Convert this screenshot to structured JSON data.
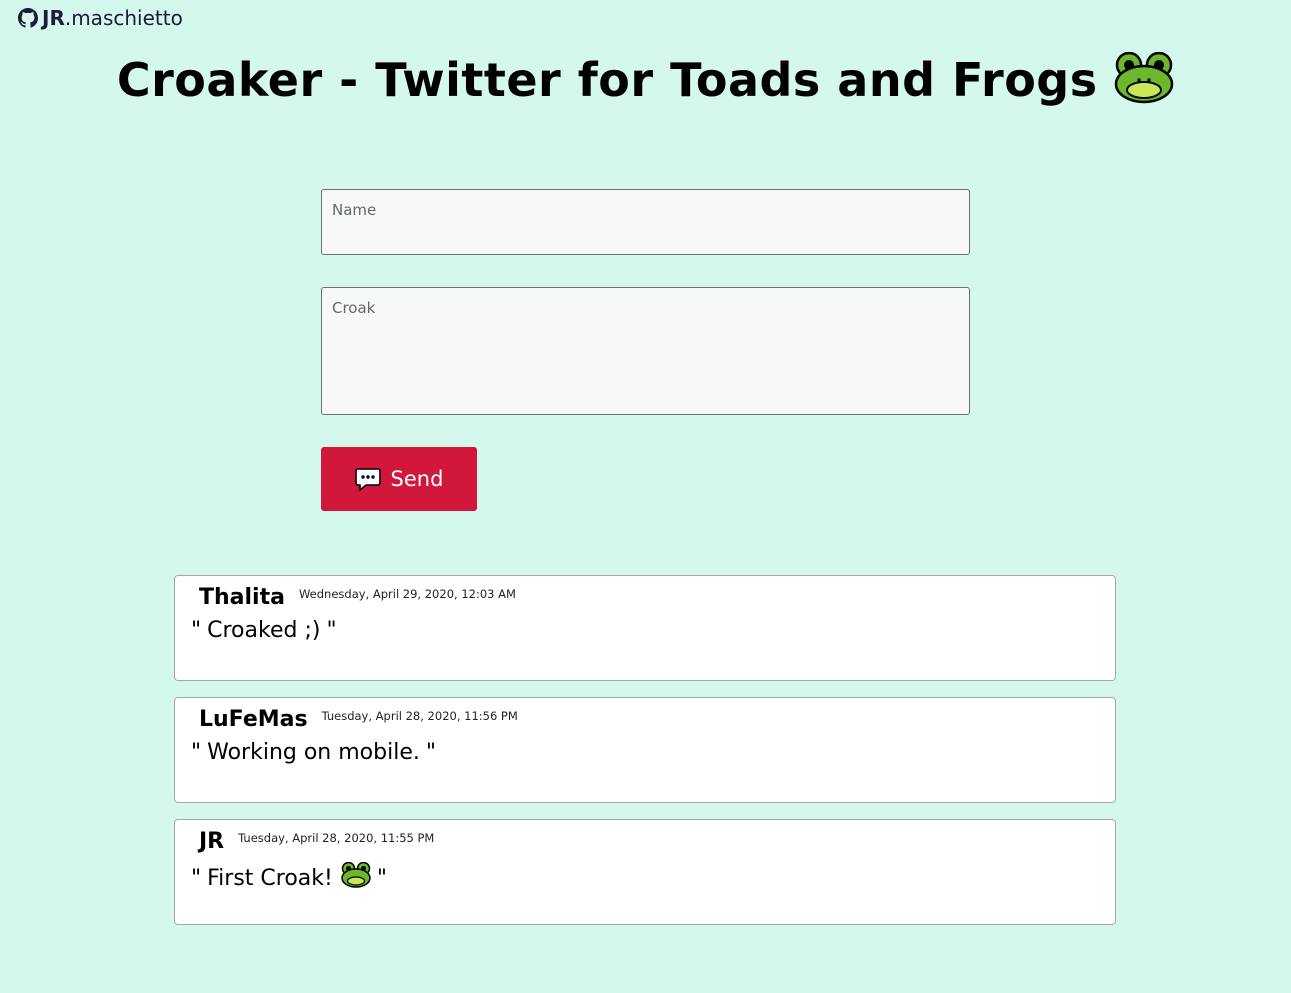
{
  "brand": {
    "bold": "JR",
    "rest": ".maschietto",
    "icon": "github-icon"
  },
  "title": "Croaker - Twitter for Toads and Frogs",
  "title_icon": "frog-face-icon",
  "form": {
    "name_placeholder": "Name",
    "croak_placeholder": "Croak",
    "send_label": "Send",
    "send_icon": "speech-bubble-icon",
    "send_color": "#d2173d"
  },
  "posts": [
    {
      "author": "Thalita",
      "date": "Wednesday, April 29, 2020, 12:03 AM",
      "open_quote": "\"",
      "text": "Croaked ;)",
      "close_quote": "\""
    },
    {
      "author": "LuFeMas",
      "date": "Tuesday, April 28, 2020, 11:56 PM",
      "open_quote": "\"",
      "text": "Working on mobile.",
      "close_quote": "\""
    },
    {
      "author": "JR",
      "date": "Tuesday, April 28, 2020, 11:55 PM",
      "open_quote": "\"",
      "text": "First Croak!",
      "close_quote": "\"",
      "emoji_icon": "frog-face-icon"
    }
  ],
  "colors": {
    "background": "#d4f8ec",
    "button": "#d2173d"
  }
}
